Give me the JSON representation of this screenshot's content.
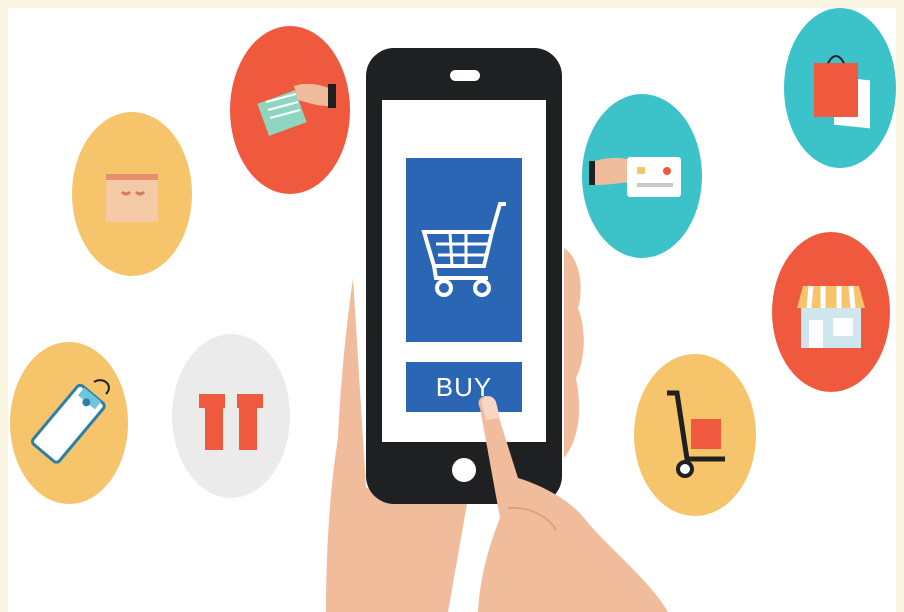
{
  "screen": {
    "buy_label": "BUY"
  },
  "icons": [
    "shipping-box-icon",
    "cash-payment-icon",
    "price-tag-icon",
    "gift-box-icon",
    "credit-card-payment-icon",
    "shopping-bags-icon",
    "storefront-icon",
    "hand-truck-icon",
    "shopping-cart-icon"
  ],
  "colors": {
    "frame": "#fbf6e2",
    "yellow_circle": "#f5c46b",
    "red_circle": "#ef5a3e",
    "teal_circle": "#3cc3c9",
    "grey_circle": "#ebebeb",
    "phone_body": "#1f2022",
    "screen_blue": "#2a66b4",
    "skin": "#f0bc9c"
  }
}
